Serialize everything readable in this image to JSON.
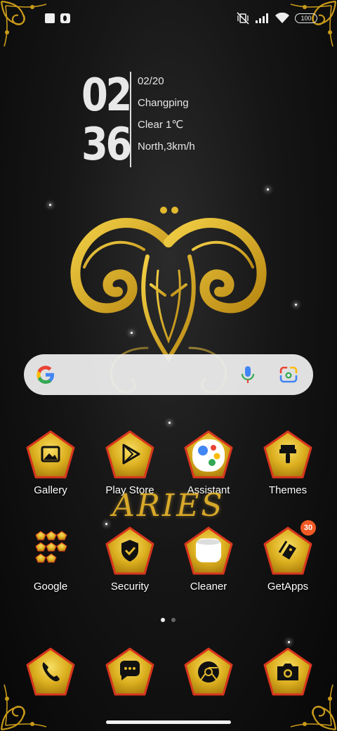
{
  "status_bar": {
    "battery": "100"
  },
  "clock": {
    "hour": "02",
    "minute": "36",
    "date": "02/20",
    "location": "Changping",
    "weather": "Clear 1℃",
    "wind": "North,3km/h"
  },
  "wallpaper": {
    "text": "ARIES"
  },
  "apps_row1": [
    {
      "label": "Gallery",
      "icon": "gallery-icon"
    },
    {
      "label": "Play Store",
      "icon": "play-store-icon"
    },
    {
      "label": "Assistant",
      "icon": "assistant-icon"
    },
    {
      "label": "Themes",
      "icon": "brush-icon"
    }
  ],
  "apps_row2": [
    {
      "label": "Google",
      "icon": "google-folder-icon"
    },
    {
      "label": "Security",
      "icon": "shield-check-icon"
    },
    {
      "label": "Cleaner",
      "icon": "cleaner-icon"
    },
    {
      "label": "GetApps",
      "icon": "getapps-icon",
      "badge": "30"
    }
  ],
  "dock": [
    {
      "icon": "phone-icon"
    },
    {
      "icon": "messages-icon"
    },
    {
      "icon": "chrome-icon"
    },
    {
      "icon": "camera-icon"
    }
  ],
  "colors": {
    "gold": "#e8c23a",
    "tile_border": "#d9361e",
    "badge": "#f15a24"
  }
}
